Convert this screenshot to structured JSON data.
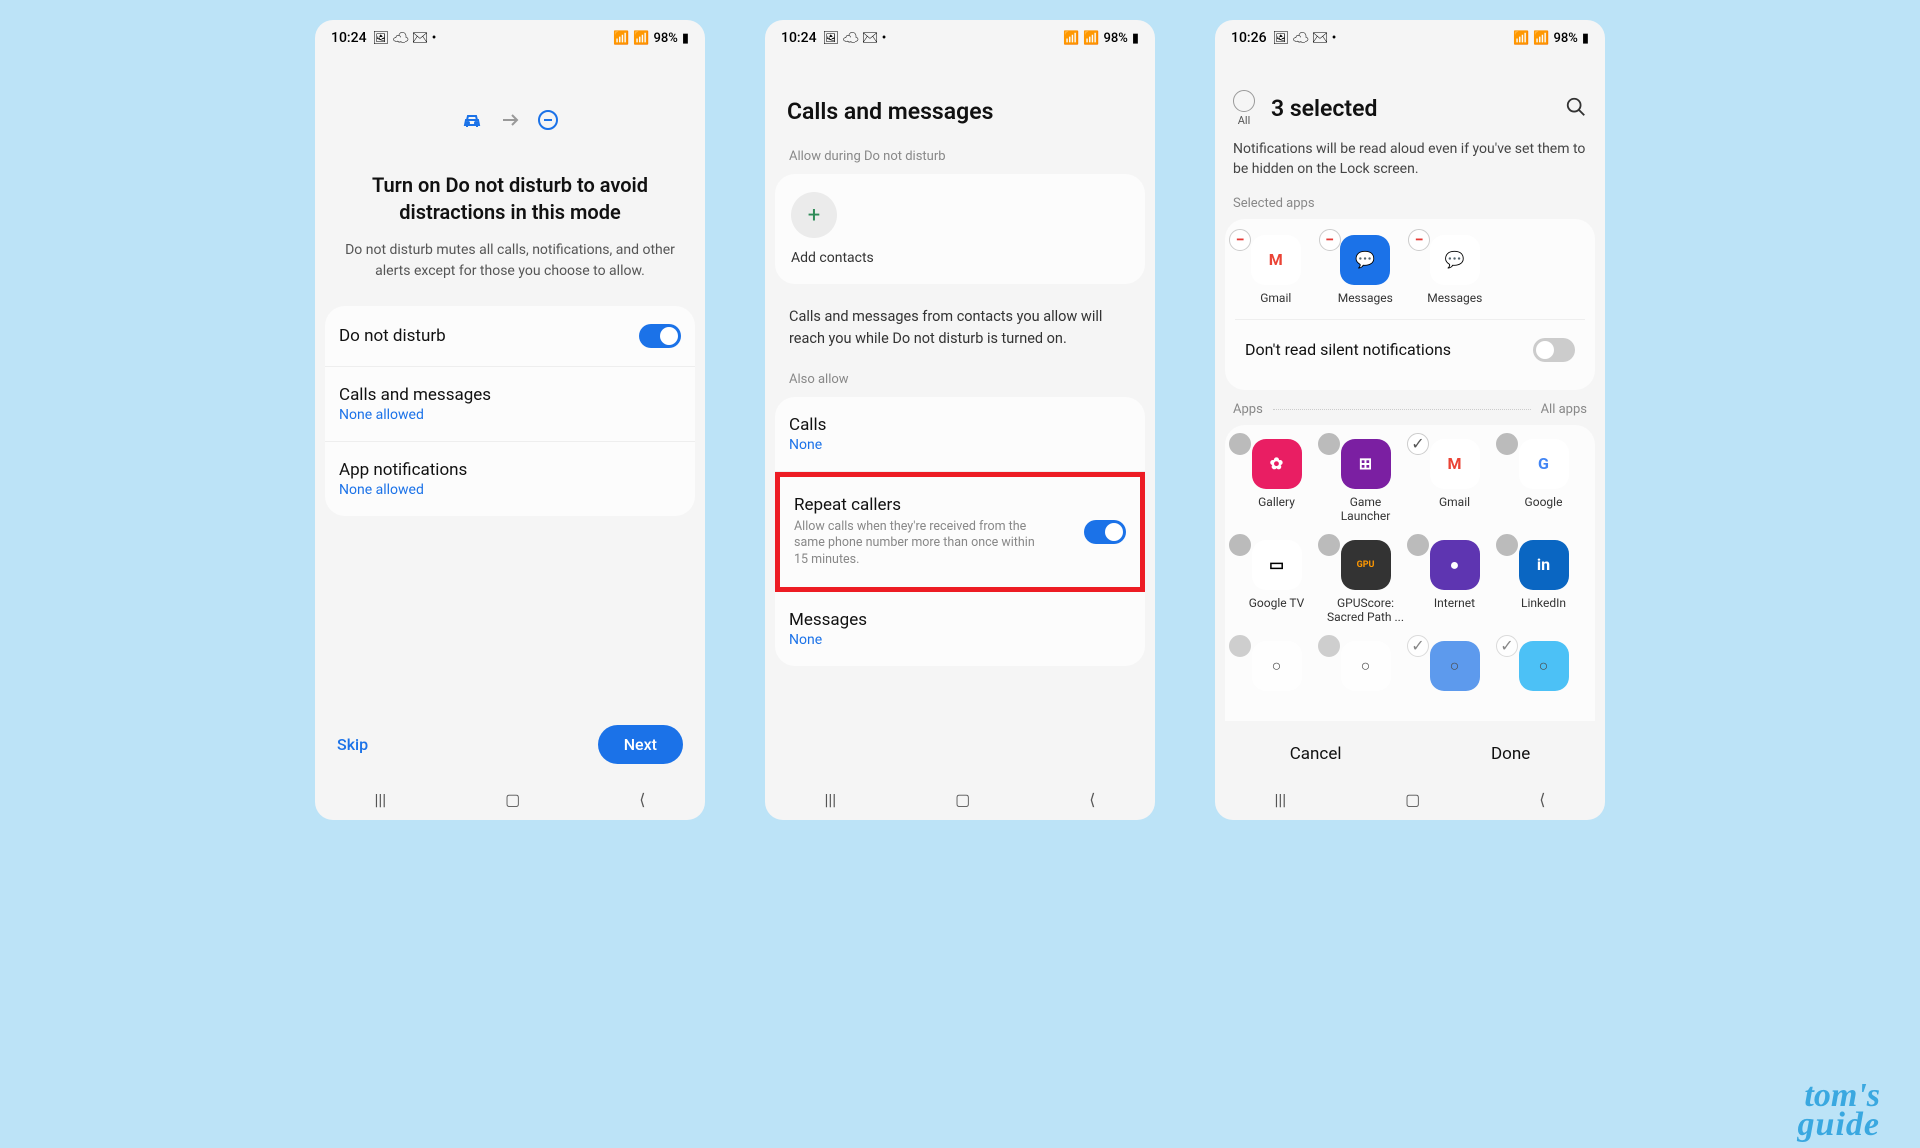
{
  "status": {
    "time1": "10:24",
    "time2": "10:24",
    "time3": "10:26",
    "battery": "98%"
  },
  "screen1": {
    "title": "Turn on Do not disturb to avoid distractions in this mode",
    "desc": "Do not disturb mutes all calls, notifications, and other alerts except for those you choose to allow.",
    "dnd_label": "Do not disturb",
    "calls_label": "Calls and messages",
    "calls_sub": "None allowed",
    "apps_label": "App notifications",
    "apps_sub": "None allowed",
    "skip": "Skip",
    "next": "Next"
  },
  "screen2": {
    "title": "Calls and messages",
    "allow_label": "Allow during Do not disturb",
    "add_contacts": "Add contacts",
    "info": "Calls and messages from contacts you allow will reach you while Do not disturb is turned on.",
    "also_allow": "Also allow",
    "calls_label": "Calls",
    "calls_sub": "None",
    "repeat_label": "Repeat callers",
    "repeat_desc": "Allow calls when they're received from the same phone number more than once within 15 minutes.",
    "messages_label": "Messages",
    "messages_sub": "None"
  },
  "screen3": {
    "all": "All",
    "title": "3 selected",
    "note": "Notifications will be read aloud even if you've set them to be hidden on the Lock screen.",
    "selected_apps": "Selected apps",
    "selected": [
      {
        "name": "Gmail"
      },
      {
        "name": "Messages"
      },
      {
        "name": "Messages"
      }
    ],
    "silent_label": "Don't read silent notifications",
    "apps_label": "Apps",
    "all_apps": "All apps",
    "grid": [
      {
        "name": "Gallery"
      },
      {
        "name": "Game Launcher"
      },
      {
        "name": "Gmail"
      },
      {
        "name": "Google"
      },
      {
        "name": "Google TV"
      },
      {
        "name": "GPUScore: Sacred Path ..."
      },
      {
        "name": "Internet"
      },
      {
        "name": "LinkedIn"
      }
    ],
    "cancel": "Cancel",
    "done": "Done"
  },
  "watermark": {
    "line1": "tom's",
    "line2": "guide"
  }
}
